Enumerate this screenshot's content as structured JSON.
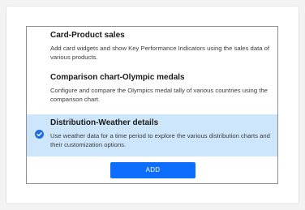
{
  "options": [
    {
      "title": "Card-Product sales",
      "description": "Add card widgets and show Key Performance Indicators using the sales data of various products.",
      "selected": false
    },
    {
      "title": "Comparison chart-Olympic medals",
      "description": "Configure and compare the Olympics medal tally of various countries using the comparison chart.",
      "selected": false
    },
    {
      "title": "Distribution-Weather details",
      "description": "Use weather data for a time period to explore the various distribution charts and their customization options.",
      "selected": true,
      "selected_icon": "check-circle-icon"
    }
  ],
  "add_button_label": "ADD",
  "colors": {
    "selected_background": "#cde6fb",
    "accent": "#0d6efd",
    "check_icon": "#1b6fe0",
    "dialog_border": "#8f8f8f"
  }
}
